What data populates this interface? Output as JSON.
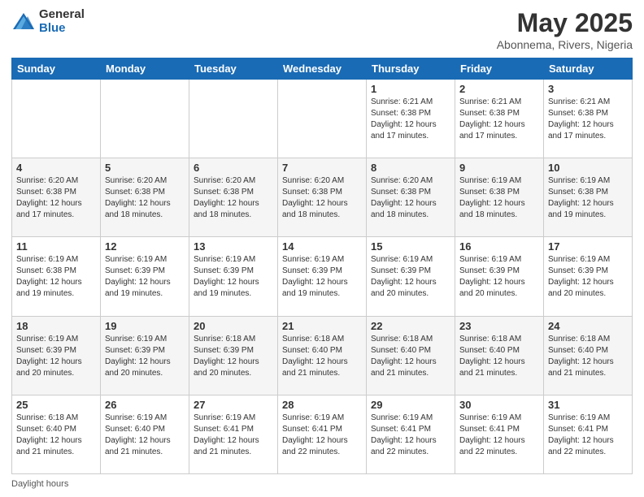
{
  "logo": {
    "general": "General",
    "blue": "Blue"
  },
  "title": "May 2025",
  "subtitle": "Abonnema, Rivers, Nigeria",
  "days_of_week": [
    "Sunday",
    "Monday",
    "Tuesday",
    "Wednesday",
    "Thursday",
    "Friday",
    "Saturday"
  ],
  "weeks": [
    [
      {
        "day": "",
        "info": ""
      },
      {
        "day": "",
        "info": ""
      },
      {
        "day": "",
        "info": ""
      },
      {
        "day": "",
        "info": ""
      },
      {
        "day": "1",
        "info": "Sunrise: 6:21 AM\nSunset: 6:38 PM\nDaylight: 12 hours and 17 minutes."
      },
      {
        "day": "2",
        "info": "Sunrise: 6:21 AM\nSunset: 6:38 PM\nDaylight: 12 hours and 17 minutes."
      },
      {
        "day": "3",
        "info": "Sunrise: 6:21 AM\nSunset: 6:38 PM\nDaylight: 12 hours and 17 minutes."
      }
    ],
    [
      {
        "day": "4",
        "info": "Sunrise: 6:20 AM\nSunset: 6:38 PM\nDaylight: 12 hours and 17 minutes."
      },
      {
        "day": "5",
        "info": "Sunrise: 6:20 AM\nSunset: 6:38 PM\nDaylight: 12 hours and 18 minutes."
      },
      {
        "day": "6",
        "info": "Sunrise: 6:20 AM\nSunset: 6:38 PM\nDaylight: 12 hours and 18 minutes."
      },
      {
        "day": "7",
        "info": "Sunrise: 6:20 AM\nSunset: 6:38 PM\nDaylight: 12 hours and 18 minutes."
      },
      {
        "day": "8",
        "info": "Sunrise: 6:20 AM\nSunset: 6:38 PM\nDaylight: 12 hours and 18 minutes."
      },
      {
        "day": "9",
        "info": "Sunrise: 6:19 AM\nSunset: 6:38 PM\nDaylight: 12 hours and 18 minutes."
      },
      {
        "day": "10",
        "info": "Sunrise: 6:19 AM\nSunset: 6:38 PM\nDaylight: 12 hours and 19 minutes."
      }
    ],
    [
      {
        "day": "11",
        "info": "Sunrise: 6:19 AM\nSunset: 6:38 PM\nDaylight: 12 hours and 19 minutes."
      },
      {
        "day": "12",
        "info": "Sunrise: 6:19 AM\nSunset: 6:39 PM\nDaylight: 12 hours and 19 minutes."
      },
      {
        "day": "13",
        "info": "Sunrise: 6:19 AM\nSunset: 6:39 PM\nDaylight: 12 hours and 19 minutes."
      },
      {
        "day": "14",
        "info": "Sunrise: 6:19 AM\nSunset: 6:39 PM\nDaylight: 12 hours and 19 minutes."
      },
      {
        "day": "15",
        "info": "Sunrise: 6:19 AM\nSunset: 6:39 PM\nDaylight: 12 hours and 20 minutes."
      },
      {
        "day": "16",
        "info": "Sunrise: 6:19 AM\nSunset: 6:39 PM\nDaylight: 12 hours and 20 minutes."
      },
      {
        "day": "17",
        "info": "Sunrise: 6:19 AM\nSunset: 6:39 PM\nDaylight: 12 hours and 20 minutes."
      }
    ],
    [
      {
        "day": "18",
        "info": "Sunrise: 6:19 AM\nSunset: 6:39 PM\nDaylight: 12 hours and 20 minutes."
      },
      {
        "day": "19",
        "info": "Sunrise: 6:19 AM\nSunset: 6:39 PM\nDaylight: 12 hours and 20 minutes."
      },
      {
        "day": "20",
        "info": "Sunrise: 6:18 AM\nSunset: 6:39 PM\nDaylight: 12 hours and 20 minutes."
      },
      {
        "day": "21",
        "info": "Sunrise: 6:18 AM\nSunset: 6:40 PM\nDaylight: 12 hours and 21 minutes."
      },
      {
        "day": "22",
        "info": "Sunrise: 6:18 AM\nSunset: 6:40 PM\nDaylight: 12 hours and 21 minutes."
      },
      {
        "day": "23",
        "info": "Sunrise: 6:18 AM\nSunset: 6:40 PM\nDaylight: 12 hours and 21 minutes."
      },
      {
        "day": "24",
        "info": "Sunrise: 6:18 AM\nSunset: 6:40 PM\nDaylight: 12 hours and 21 minutes."
      }
    ],
    [
      {
        "day": "25",
        "info": "Sunrise: 6:18 AM\nSunset: 6:40 PM\nDaylight: 12 hours and 21 minutes."
      },
      {
        "day": "26",
        "info": "Sunrise: 6:19 AM\nSunset: 6:40 PM\nDaylight: 12 hours and 21 minutes."
      },
      {
        "day": "27",
        "info": "Sunrise: 6:19 AM\nSunset: 6:41 PM\nDaylight: 12 hours and 21 minutes."
      },
      {
        "day": "28",
        "info": "Sunrise: 6:19 AM\nSunset: 6:41 PM\nDaylight: 12 hours and 22 minutes."
      },
      {
        "day": "29",
        "info": "Sunrise: 6:19 AM\nSunset: 6:41 PM\nDaylight: 12 hours and 22 minutes."
      },
      {
        "day": "30",
        "info": "Sunrise: 6:19 AM\nSunset: 6:41 PM\nDaylight: 12 hours and 22 minutes."
      },
      {
        "day": "31",
        "info": "Sunrise: 6:19 AM\nSunset: 6:41 PM\nDaylight: 12 hours and 22 minutes."
      }
    ]
  ],
  "footer": "Daylight hours"
}
